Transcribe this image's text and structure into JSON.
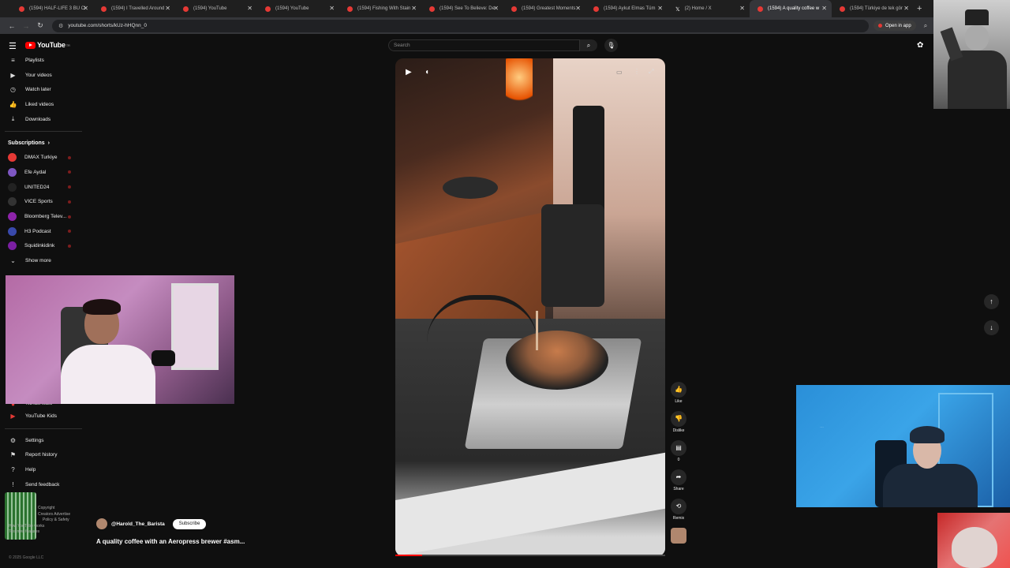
{
  "browser": {
    "tabs": [
      {
        "title": "(1594) HALF-LIFE 3 BU Cl",
        "icon": "youtube-favicon"
      },
      {
        "title": "(1594) I Travelled Around",
        "icon": "youtube-favicon"
      },
      {
        "title": "(1594) YouTube",
        "icon": "youtube-favicon"
      },
      {
        "title": "(1594) YouTube",
        "icon": "youtube-favicon"
      },
      {
        "title": "(1594) Fishing With Stain",
        "icon": "youtube-favicon"
      },
      {
        "title": "(1594) See To Believe: De",
        "icon": "youtube-favicon"
      },
      {
        "title": "(1594) Greatest Moments",
        "icon": "youtube-favicon"
      },
      {
        "title": "(1594) Aykut Elmas Tüm",
        "icon": "youtube-favicon"
      },
      {
        "title": "(2) Home / X",
        "icon": "x-favicon"
      },
      {
        "title": "(1594) A quality coffee w",
        "icon": "youtube-favicon",
        "active": true
      },
      {
        "title": "(1594) Türkiye de tek gör",
        "icon": "youtube-favicon"
      }
    ],
    "url": "youtube.com/shorts/kUz-hHQnn_0",
    "open_in_app": "Open in app"
  },
  "header": {
    "logo_text": "YouTube",
    "logo_sup": "TR",
    "search_placeholder": "Search"
  },
  "sidebar": {
    "items": [
      {
        "label": "Playlists",
        "icon": "playlist-icon"
      },
      {
        "label": "Your videos",
        "icon": "video-icon"
      },
      {
        "label": "Watch later",
        "icon": "clock-icon"
      },
      {
        "label": "Liked videos",
        "icon": "thumbs-up-icon"
      },
      {
        "label": "Downloads",
        "icon": "download-icon"
      }
    ],
    "subscriptions_title": "Subscriptions",
    "subscriptions": [
      {
        "label": "DMAX Turkiye",
        "color": "#e53935"
      },
      {
        "label": "Efe Aydal",
        "color": "#7e57c2"
      },
      {
        "label": "UNITED24",
        "color": "#222222"
      },
      {
        "label": "VICE Sports",
        "color": "#333333"
      },
      {
        "label": "Bloomberg Telev...",
        "color": "#8e24aa"
      },
      {
        "label": "H3 Podcast",
        "color": "#3949ab"
      },
      {
        "label": "Squidinkidink",
        "color": "#7b1fa2"
      }
    ],
    "show_more": "Show more",
    "more_items": [
      {
        "label": "YouTube Music",
        "icon": "youtube-music-icon"
      },
      {
        "label": "YouTube Kids",
        "icon": "youtube-kids-icon"
      }
    ],
    "bottom_items": [
      {
        "label": "Settings",
        "icon": "gear-icon"
      },
      {
        "label": "Report history",
        "icon": "flag-icon"
      },
      {
        "label": "Help",
        "icon": "help-icon"
      },
      {
        "label": "Send feedback",
        "icon": "feedback-icon"
      }
    ],
    "footer_lines": [
      "Copyright",
      "Creators  Advertise",
      "Policy & Safety",
      "How YouTube works",
      "Test new features"
    ],
    "copyright": "© 2025 Google LLC"
  },
  "short": {
    "channel": "@Harold_The_Barista",
    "subscribe": "Subscribe",
    "title": "A quality coffee with an Aeropress brewer #asm...",
    "progress_fraction": 0.1
  },
  "actions": [
    {
      "label": "Like",
      "icon": "thumbs-up-icon"
    },
    {
      "label": "Dislike",
      "icon": "thumbs-down-icon"
    },
    {
      "label": "0",
      "icon": "comment-icon"
    },
    {
      "label": "Share",
      "icon": "share-icon"
    },
    {
      "label": "Remix",
      "icon": "remix-icon"
    }
  ],
  "overlay": {
    "cam2_text": "…"
  }
}
